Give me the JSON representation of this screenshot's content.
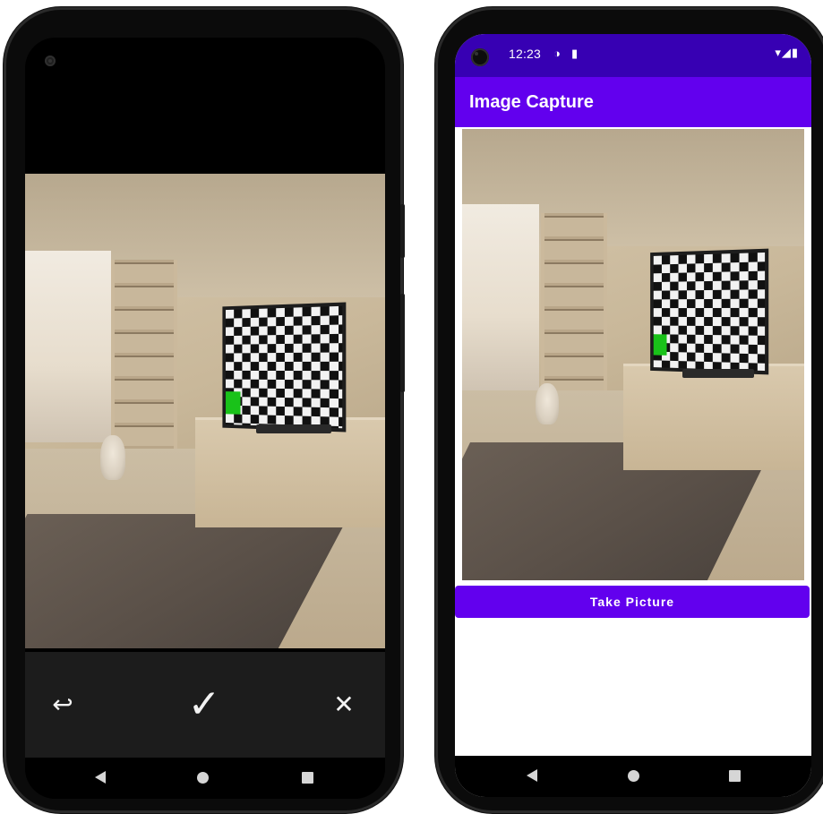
{
  "left_phone": {
    "review_toolbar": {
      "retry_icon": "↩",
      "accept_icon": "✓",
      "cancel_icon": "✕"
    },
    "nav_icons": [
      "back-triangle",
      "home-circle",
      "recent-square"
    ]
  },
  "right_phone": {
    "status_bar": {
      "time": "12:23",
      "left_icons": [
        "◑",
        "▮"
      ],
      "right_icons": "▾◢▮"
    },
    "app_bar": {
      "title": "Image Capture"
    },
    "take_picture_button": {
      "label": "Take Picture"
    },
    "nav_icons": [
      "back-triangle",
      "home-circle",
      "recent-square"
    ]
  },
  "colors": {
    "primary": "#6200ee",
    "primary_dark": "#3700b3",
    "review_toolbar": "#1c1c1c",
    "nav_bar": "#000000"
  }
}
